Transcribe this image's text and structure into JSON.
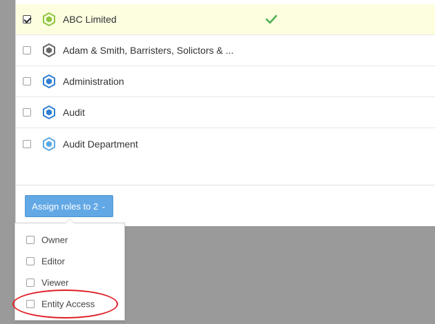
{
  "colors": {
    "accent": "#62a8e5",
    "selected_row": "#fdfde0",
    "check_green": "#4caf50",
    "hex_green": "#8dc63f",
    "hex_grey": "#666666",
    "hex_blue": "#2f7fd1",
    "hex_lightblue": "#5aa9e6",
    "highlight_circle": "#e01e26"
  },
  "entities": [
    {
      "label": "ABC Limited",
      "checked": true,
      "icon": "hexagon-green-icon",
      "status_icon": "checkmark-icon"
    },
    {
      "label": "Adam & Smith, Barristers, Solictors & ...",
      "checked": false,
      "icon": "hexagon-grey-icon"
    },
    {
      "label": "Administration",
      "checked": false,
      "icon": "hexagon-blue-icon"
    },
    {
      "label": "Audit",
      "checked": false,
      "icon": "hexagon-blue-icon"
    },
    {
      "label": "Audit Department",
      "checked": false,
      "icon": "hexagon-lightblue-icon"
    }
  ],
  "assign_button": {
    "label": "Assign roles to 2",
    "icon": "chevron-down-icon"
  },
  "roles_menu": [
    {
      "label": "Owner",
      "checked": false
    },
    {
      "label": "Editor",
      "checked": false
    },
    {
      "label": "Viewer",
      "checked": false
    },
    {
      "label": "Entity Access",
      "checked": false,
      "highlighted": true
    }
  ]
}
